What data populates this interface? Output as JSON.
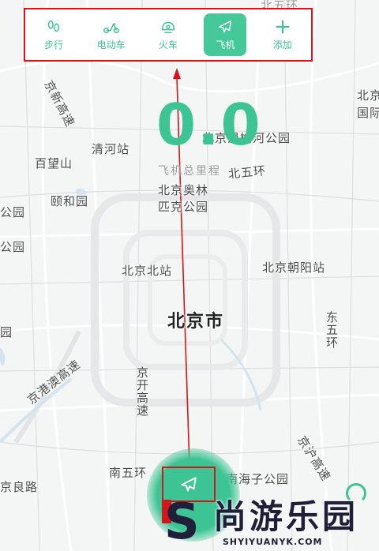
{
  "mode_bar": {
    "modes": [
      {
        "label": "步行",
        "icon": "footprints-icon",
        "active": false
      },
      {
        "label": "电动车",
        "icon": "scooter-icon",
        "active": false
      },
      {
        "label": "火车",
        "icon": "train-icon",
        "active": false
      },
      {
        "label": "飞机",
        "icon": "airplane-icon",
        "active": true
      },
      {
        "label": "添加",
        "icon": "plus-icon",
        "active": false
      }
    ]
  },
  "distance": {
    "value": "0.0",
    "label": "飞机总里程"
  },
  "map": {
    "city": "北京市",
    "labels": {
      "beiwuhuan_top": "北五环",
      "jingxin": "京新高速",
      "beijing_guo": "北京",
      "guoji": "国际",
      "wenyu": "北京温榆河公园",
      "qinghe": "清河站",
      "baiwang": "百望山",
      "beiwuhuan": "北五环",
      "olympic1": "北京奥林",
      "olympic2": "匹克公园",
      "yiheyuan": "颐和园",
      "gongyuan1": "公园",
      "gongyuan2": "公园",
      "beijing_north": "北京北站",
      "chaoyang": "北京朝阳站",
      "yuan": "园",
      "dongwuhuan": "东五环",
      "jinggangao": "京港澳高速",
      "jingkai": "京开高速",
      "jinghu": "京沪高速",
      "nanwuhuan": "南五环",
      "nanhaizi": "南海子公园",
      "jingliang": "京良路"
    }
  },
  "watermark": {
    "logo": "S",
    "title": "尚游乐园",
    "url": "SHYIYUANYK.COM"
  },
  "colors": {
    "accent": "#3cc494",
    "highlight": "#d8141b"
  }
}
